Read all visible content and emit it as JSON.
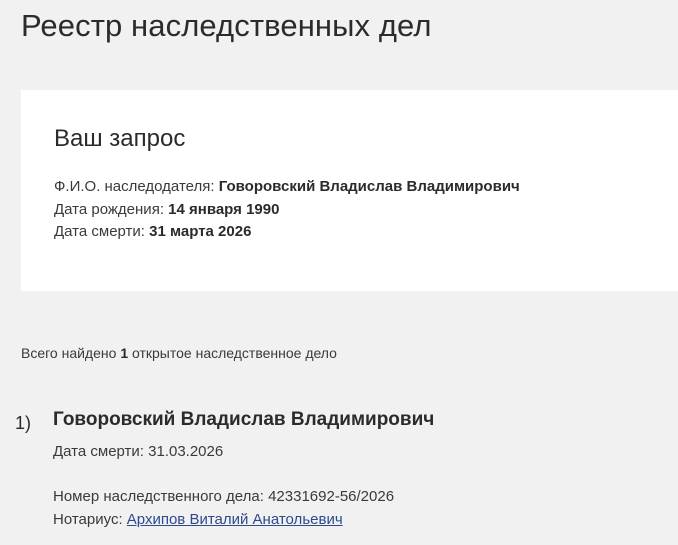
{
  "page": {
    "title": "Реестр наследственных дел"
  },
  "query": {
    "title": "Ваш запрос",
    "fio_label": "Ф.И.О. наследодателя:",
    "fio_value": "Говоровский Владислав Владимирович",
    "birth_label": "Дата рождения:",
    "birth_value": "14 января 1990",
    "death_label": "Дата смерти:",
    "death_value": "31 марта 2026"
  },
  "summary": {
    "prefix": "Всего найдено",
    "count": "1",
    "suffix": "открытое наследственное дело"
  },
  "results": [
    {
      "index": "1)",
      "name": "Говоровский Владислав Владимирович",
      "death_label": "Дата смерти:",
      "death_value": "31.03.2026",
      "case_label": "Номер наследственного дела:",
      "case_value": "42331692-56/2026",
      "notary_label": "Нотариус:",
      "notary_value": "Архипов Виталий Анатольевич"
    }
  ]
}
